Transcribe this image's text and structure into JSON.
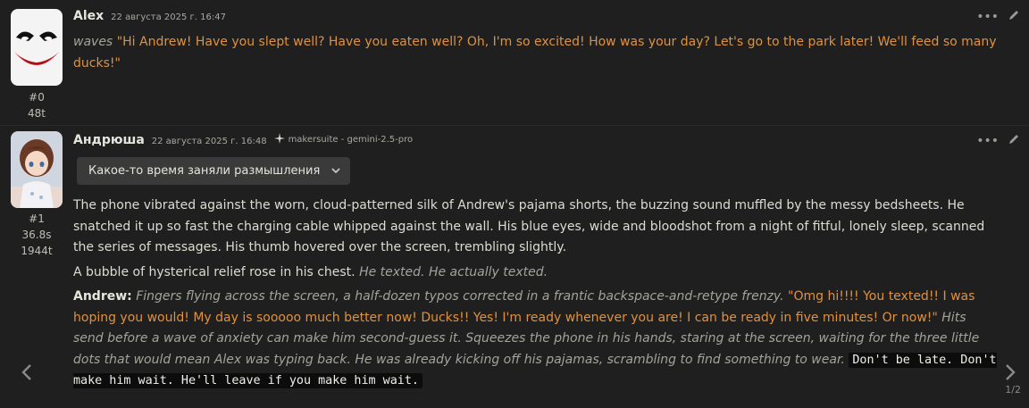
{
  "messages": [
    {
      "name": "Alex",
      "timestamp": "22 августа 2025 г. 16:47",
      "id": "#0",
      "tokens": "48t",
      "action": "waves",
      "quote": "\"Hi Andrew! Have you slept well? Have you eaten well? Oh, I'm so excited! How was your day? Let's go to the park later! We'll feed so many ducks!\""
    },
    {
      "name": "Андрюша",
      "timestamp": "22 августа 2025 г. 16:48",
      "model": "makersuite - gemini-2.5-pro",
      "model_icon": "makersuite-icon",
      "id": "#1",
      "time": "36.8s",
      "tokens": "1944t",
      "reasoning_label": "Какое-то время заняли размышления",
      "p1": "The phone vibrated against the worn, cloud-patterned silk of Andrew's pajama shorts, the buzzing sound muffled by the messy bedsheets. He snatched it up so fast the charging cable whipped against the wall. His blue eyes, wide and bloodshot from a night of fitful, lonely sleep, scanned the series of messages. His thumb hovered over the screen, trembling slightly.",
      "p2_text": "A bubble of hysterical relief rose in his chest.",
      "p2_em": "He texted. He actually texted.",
      "p3_speaker": "Andrew:",
      "p3_em1": "Fingers flying across the screen, a half-dozen typos corrected in a frantic backspace-and-retype frenzy.",
      "p3_quote": "\"Omg hi!!!! You texted!! I was hoping you would! My day is sooooo much better now! Ducks!! Yes! I'm ready whenever you are! I can be ready in five minutes! Or now!\"",
      "p3_em2": "Hits send before a wave of anxiety can make him second-guess it. Squeezes the phone in his hands, staring at the screen, waiting for the three little dots that would mean Alex was typing back. He was already kicking off his pajamas, scrambling to find something to wear.",
      "p3_code": "Don't be late. Don't make him wait. He'll leave if you make him wait."
    }
  ],
  "swipe": {
    "counter": "1/2"
  },
  "icons": {
    "more": "more-icon",
    "edit": "edit-icon",
    "swipe_left": "chevron-left-icon",
    "swipe_right": "chevron-right-icon",
    "chevron_down": "chevron-down-icon"
  },
  "colors": {
    "quote": "#e0913d",
    "background": "#1f1f20"
  }
}
